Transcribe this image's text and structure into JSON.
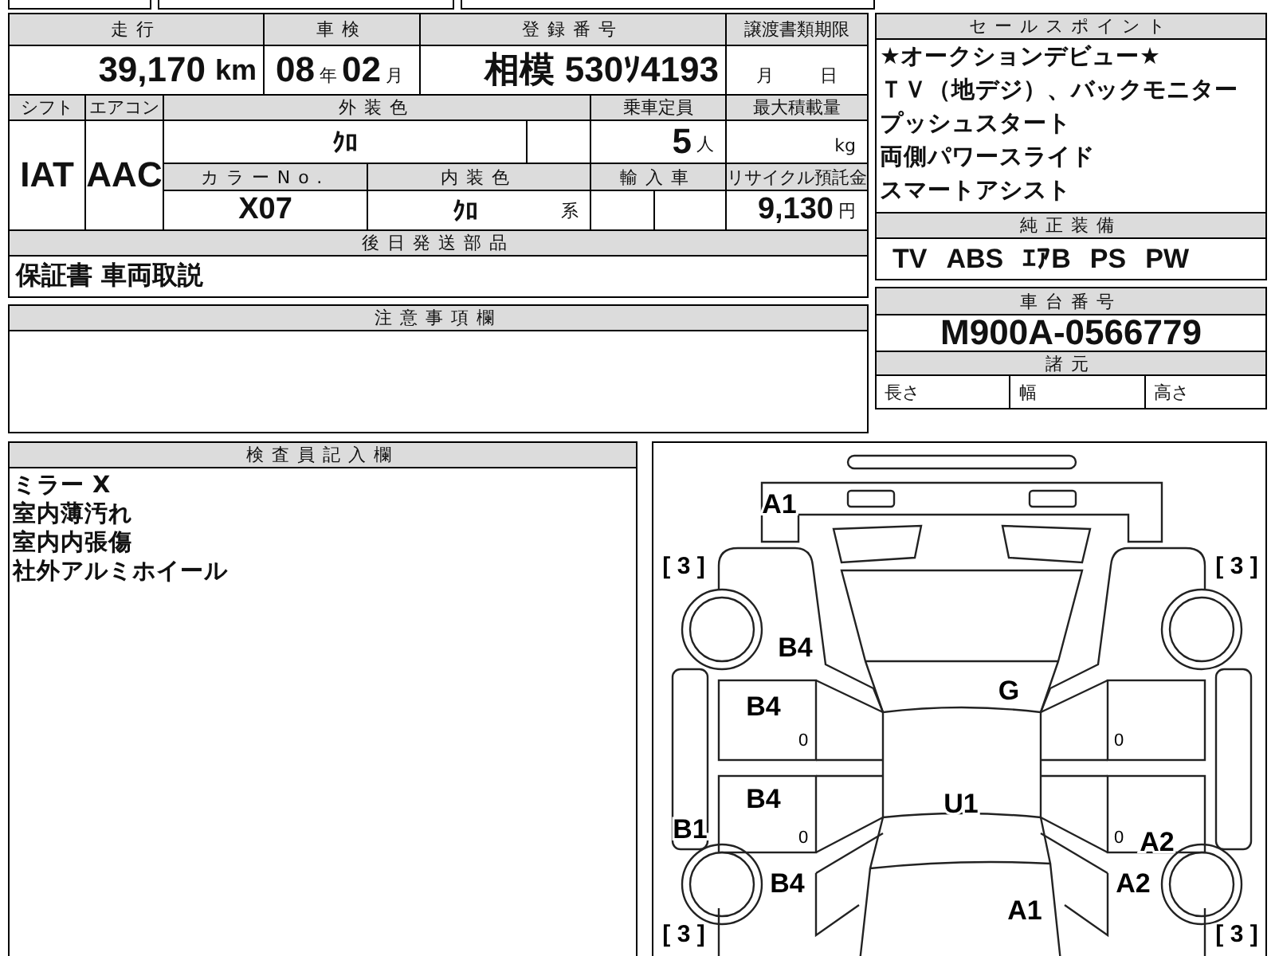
{
  "vehicle_info": {
    "mileage": {
      "label": "走行",
      "value": "39,170",
      "unit": "km"
    },
    "inspection": {
      "label": "車検",
      "year": "08",
      "year_unit": "年",
      "month": "02",
      "month_unit": "月"
    },
    "registration": {
      "label": "登録番号",
      "value": "相模 530ｿ4193"
    },
    "transfer_deadline": {
      "label": "譲渡書類期限",
      "month_unit": "月",
      "day_unit": "日"
    },
    "shift": {
      "label": "シフト",
      "value": "IAT"
    },
    "aircon": {
      "label": "エアコン",
      "value": "AAC"
    },
    "exterior_color": {
      "label": "外装色",
      "value": "ｸﾛ"
    },
    "capacity": {
      "label": "乗車定員",
      "value": "5",
      "unit": "人"
    },
    "max_load": {
      "label": "最大積載量",
      "unit": "kg"
    },
    "color_no": {
      "label": "カラーNo.",
      "value": "X07"
    },
    "interior_color": {
      "label": "内装色",
      "value": "ｸﾛ",
      "unit": "系"
    },
    "imported": {
      "label": "輸入車"
    },
    "recycle_fee": {
      "label": "リサイクル預託金",
      "value": "9,130",
      "unit": "円"
    },
    "later_parts": {
      "label": "後日発送部品",
      "value": "保証書 車両取説"
    }
  },
  "notes": {
    "label": "注意事項欄"
  },
  "sales_points": {
    "label": "セールスポイント",
    "items": [
      "★オークションデビュー★",
      "ＴＶ（地デジ）、バックモニター",
      "プッシュスタート",
      "両側パワースライド",
      "スマートアシスト"
    ]
  },
  "equipment": {
    "label": "純正装備",
    "items": [
      "TV",
      "ABS",
      "ｴｱB",
      "PS",
      "PW"
    ]
  },
  "chassis": {
    "label": "車台番号",
    "value": "M900A-0566779"
  },
  "specs": {
    "label": "諸元",
    "items": [
      "長さ",
      "幅",
      "高さ"
    ]
  },
  "inspector": {
    "label": "検査員記入欄",
    "lines": [
      "ミラー X",
      "室内薄汚れ",
      "室内内張傷",
      "社外アルミホイール"
    ]
  },
  "diagram": {
    "marks": [
      {
        "kind": "code",
        "text": "A1"
      },
      {
        "kind": "tire",
        "text": "[ 3 ]"
      },
      {
        "kind": "tire",
        "text": "[ 3 ]"
      },
      {
        "kind": "code",
        "text": "B4"
      },
      {
        "kind": "code",
        "text": "G"
      },
      {
        "kind": "code",
        "text": "B4"
      },
      {
        "kind": "door",
        "text": "0"
      },
      {
        "kind": "door",
        "text": "0"
      },
      {
        "kind": "code",
        "text": "B4"
      },
      {
        "kind": "code",
        "text": "U1"
      },
      {
        "kind": "code",
        "text": "B1"
      },
      {
        "kind": "door",
        "text": "0"
      },
      {
        "kind": "door",
        "text": "0"
      },
      {
        "kind": "code",
        "text": "A2"
      },
      {
        "kind": "code",
        "text": "B4"
      },
      {
        "kind": "code",
        "text": "A2"
      },
      {
        "kind": "code",
        "text": "A1"
      },
      {
        "kind": "tire",
        "text": "[ 3 ]"
      },
      {
        "kind": "tire",
        "text": "[ 3 ]"
      }
    ]
  }
}
